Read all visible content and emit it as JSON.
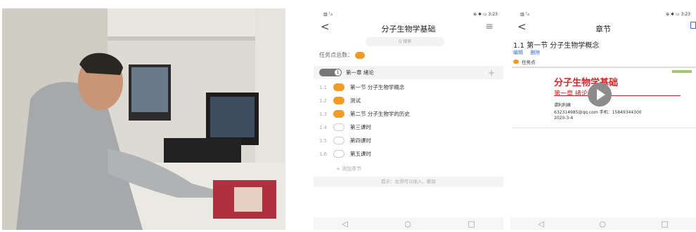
{
  "photo": {
    "label": "photo"
  },
  "screen1": {
    "status_left": "▥ ᵀᵢₗₗ",
    "status_right": "⊕ ✱ ▭ 3:23",
    "back": "<",
    "title": "分子生物学基础",
    "menu": "≡",
    "search_placeholder": "Q 搜索",
    "task_count_label": "任务点总数：",
    "chapter": {
      "order": "1",
      "label": "第一章 绪论",
      "plus": "+"
    },
    "items": [
      {
        "num": "1.1",
        "label": "第一节 分子生物学概念",
        "done": true
      },
      {
        "num": "1.2",
        "label": "测试",
        "done": true
      },
      {
        "num": "1.3",
        "label": "第二节 分子生物学的历史",
        "done": true
      },
      {
        "num": "1.4",
        "label": "第三课时",
        "done": false
      },
      {
        "num": "1.5",
        "label": "第四课时",
        "done": false
      },
      {
        "num": "1.6",
        "label": "第五课时",
        "done": false
      }
    ],
    "add_label": "+ 添加章节",
    "hint": "提示：左滑可以插入、删除",
    "nav": [
      "◁",
      "○",
      "□"
    ]
  },
  "screen2": {
    "status_left": "▥ ᵀᵢₗₗ",
    "status_right": "⊕ ✱ ▭ 3:23",
    "back": "<",
    "title": "章节",
    "section_title": "1.1 第一节 分子生物学概念",
    "links": [
      "编辑",
      "删除"
    ],
    "task_label": "任务点",
    "video": {
      "title": "分子生物学基础",
      "subtitle": "第一章 绪论",
      "author": "谭利利峰",
      "contact": "632314985@qq.com  手机：15849344300",
      "date": "2020-3-4"
    },
    "nav": [
      "◁",
      "○",
      "□"
    ]
  }
}
